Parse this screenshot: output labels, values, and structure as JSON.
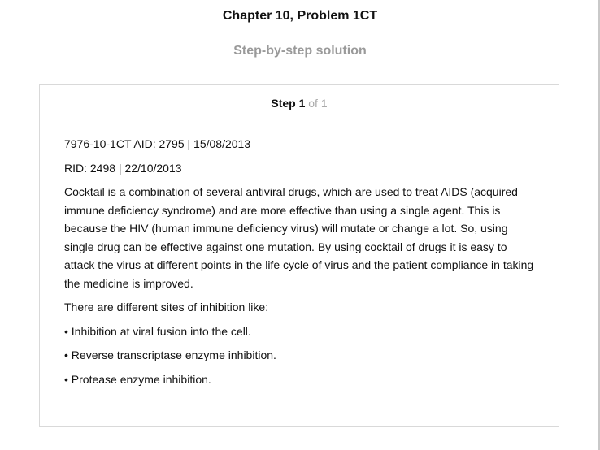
{
  "header": {
    "title": "Chapter 10, Problem 1CT",
    "subtitle": "Step-by-step solution"
  },
  "step": {
    "label": "Step 1",
    "of_text": "of 1"
  },
  "content": {
    "meta_line_1": "7976-10-1CT AID: 2795 | 15/08/2013",
    "meta_line_2": "RID: 2498 | 22/10/2013",
    "paragraph": "Cocktail is a combination of several antiviral drugs, which are used to treat AIDS (acquired immune deficiency syndrome) and are more effective than using a single agent. This is because the HIV (human immune deficiency virus) will mutate or change a lot. So, using single drug can be effective against one mutation. By using cocktail of drugs it is easy to attack the virus at different points in the life cycle of virus and the patient compliance in taking the medicine is improved.",
    "intro_list": "There are different sites of inhibition like:",
    "bullets": [
      "• Inhibition at viral fusion into the cell.",
      "• Reverse transcriptase enzyme inhibition.",
      "• Protease enzyme inhibition."
    ]
  }
}
